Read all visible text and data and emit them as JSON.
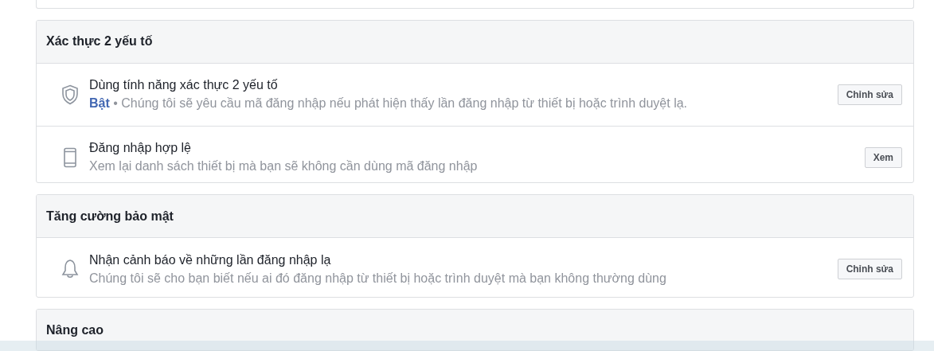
{
  "sections": [
    {
      "title": "Xác thực 2 yếu tố",
      "rows": [
        {
          "kind": "shield",
          "title": "Dùng tính năng xác thực 2 yếu tố",
          "status": "Bật",
          "separator": "•",
          "description": "Chúng tôi sẽ yêu cầu mã đăng nhập nếu phát hiện thấy lần đăng nhập từ thiết bị hoặc trình duyệt lạ.",
          "button": "Chỉnh sửa"
        },
        {
          "kind": "phone",
          "title": "Đăng nhập hợp lệ",
          "description": "Xem lại danh sách thiết bị mà bạn sẽ không cần dùng mã đăng nhập",
          "button": "Xem"
        }
      ]
    },
    {
      "title": "Tăng cường bảo mật",
      "rows": [
        {
          "kind": "bell",
          "title": "Nhận cảnh báo về những lần đăng nhập lạ",
          "description": "Chúng tôi sẽ cho bạn biết nếu ai đó đăng nhập từ thiết bị hoặc trình duyệt mà bạn không thường dùng",
          "button": "Chỉnh sửa"
        }
      ]
    },
    {
      "title": "Nâng cao"
    }
  ]
}
